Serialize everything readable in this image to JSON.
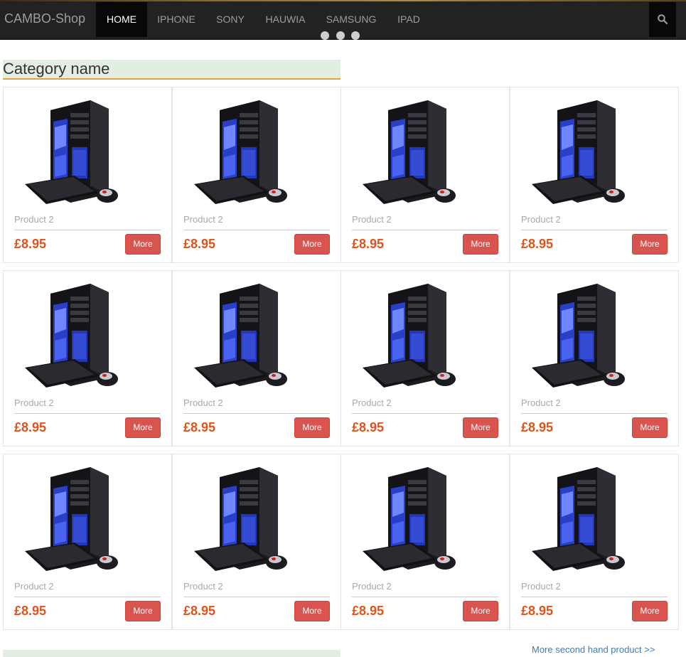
{
  "navbar": {
    "brand": "CAMBO-Shop",
    "items": [
      {
        "label": "HOME",
        "active": true
      },
      {
        "label": "IPHONE",
        "active": false
      },
      {
        "label": "SONY",
        "active": false
      },
      {
        "label": "HAUWIA",
        "active": false
      },
      {
        "label": "SAMSUNG",
        "active": false
      },
      {
        "label": "IPAD",
        "active": false
      }
    ],
    "search_icon": "search-icon"
  },
  "section": {
    "title": "Category name",
    "products": [
      {
        "name": "Product 2",
        "price": "£8.95",
        "button": "More"
      },
      {
        "name": "Product 2",
        "price": "£8.95",
        "button": "More"
      },
      {
        "name": "Product 2",
        "price": "£8.95",
        "button": "More"
      },
      {
        "name": "Product 2",
        "price": "£8.95",
        "button": "More"
      },
      {
        "name": "Product 2",
        "price": "£8.95",
        "button": "More"
      },
      {
        "name": "Product 2",
        "price": "£8.95",
        "button": "More"
      },
      {
        "name": "Product 2",
        "price": "£8.95",
        "button": "More"
      },
      {
        "name": "Product 2",
        "price": "£8.95",
        "button": "More"
      },
      {
        "name": "Product 2",
        "price": "£8.95",
        "button": "More"
      },
      {
        "name": "Product 2",
        "price": "£8.95",
        "button": "More"
      },
      {
        "name": "Product 2",
        "price": "£8.95",
        "button": "More"
      },
      {
        "name": "Product 2",
        "price": "£8.95",
        "button": "More"
      }
    ]
  },
  "footer_link": "More second hand product >>",
  "colors": {
    "navbar_bg": "#222222",
    "price": "#e0531a",
    "button": "#d9534f",
    "link": "#3a7cc0",
    "category_bg": "#e3eee2",
    "category_underline": "#e0a146"
  }
}
